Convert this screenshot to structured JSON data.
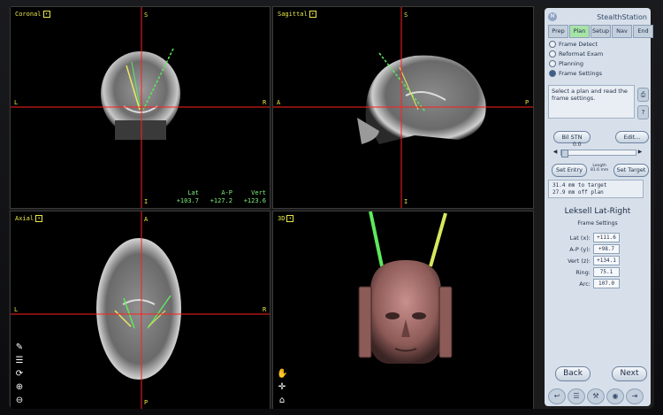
{
  "brand": {
    "name": "StealthStation",
    "logo_text": "M"
  },
  "tabs": [
    "Prep",
    "Plan",
    "Setup",
    "Nav",
    "End"
  ],
  "steps": [
    {
      "label": "Frame Detect",
      "selected": false
    },
    {
      "label": "Reformat Exam",
      "selected": false
    },
    {
      "label": "Planning",
      "selected": false
    },
    {
      "label": "Frame Settings",
      "selected": true
    }
  ],
  "help_text": "Select a plan and read the frame settings.",
  "plan": {
    "name": "Bil STN",
    "edit_label": "Edit...",
    "slider_value": "0.0",
    "set_entry": "Set Entry",
    "set_target": "Set Target",
    "length_label": "Length",
    "length_value": "81.6 mm",
    "status_line1": "31.4 mm to target",
    "status_line2": "27.9 mm off plan"
  },
  "frame": {
    "title": "Leksell Lat-Right",
    "subtitle": "Frame Settings",
    "fields": [
      {
        "label": "Lat (x):",
        "value": "+111.6"
      },
      {
        "label": "A-P (y):",
        "value": "+98.7"
      },
      {
        "label": "Vert (z):",
        "value": "+134.1"
      },
      {
        "label": "Ring:",
        "value": "75.1"
      },
      {
        "label": "Arc:",
        "value": "107.0"
      }
    ]
  },
  "nav_buttons": {
    "back": "Back",
    "next": "Next"
  },
  "viewports": {
    "coronal": {
      "title": "Coronal",
      "top": "S",
      "bottom": "I",
      "left": "L",
      "right": "R",
      "coord_labels": [
        "Lat",
        "A-P",
        "Vert"
      ],
      "coord_values": [
        "+103.7",
        "+127.2",
        "+123.6"
      ]
    },
    "sagittal": {
      "title": "Sagittal",
      "top": "S",
      "bottom": "I",
      "left": "A",
      "right": "P"
    },
    "axial": {
      "title": "Axial",
      "top": "A",
      "bottom": "P",
      "left": "L",
      "right": "R"
    },
    "threed": {
      "title": "3D"
    }
  },
  "icons": {
    "axial_tools": [
      "ruler-icon",
      "list-icon",
      "rotate-icon",
      "zoom-in-icon",
      "zoom-out-icon"
    ],
    "threed_tools": [
      "hand-icon",
      "move-icon",
      "home-icon"
    ],
    "bottom": [
      "undo-icon",
      "list-icon",
      "tools-icon",
      "camera-icon",
      "export-icon"
    ]
  },
  "colors": {
    "crosshair": "#ff2020",
    "label": "#e8e84a",
    "trajectory_green": "#5ee85e",
    "trajectory_yellow": "#e8e85e",
    "coords": "#7ef07e",
    "active_tab": "#a6e3a6"
  }
}
